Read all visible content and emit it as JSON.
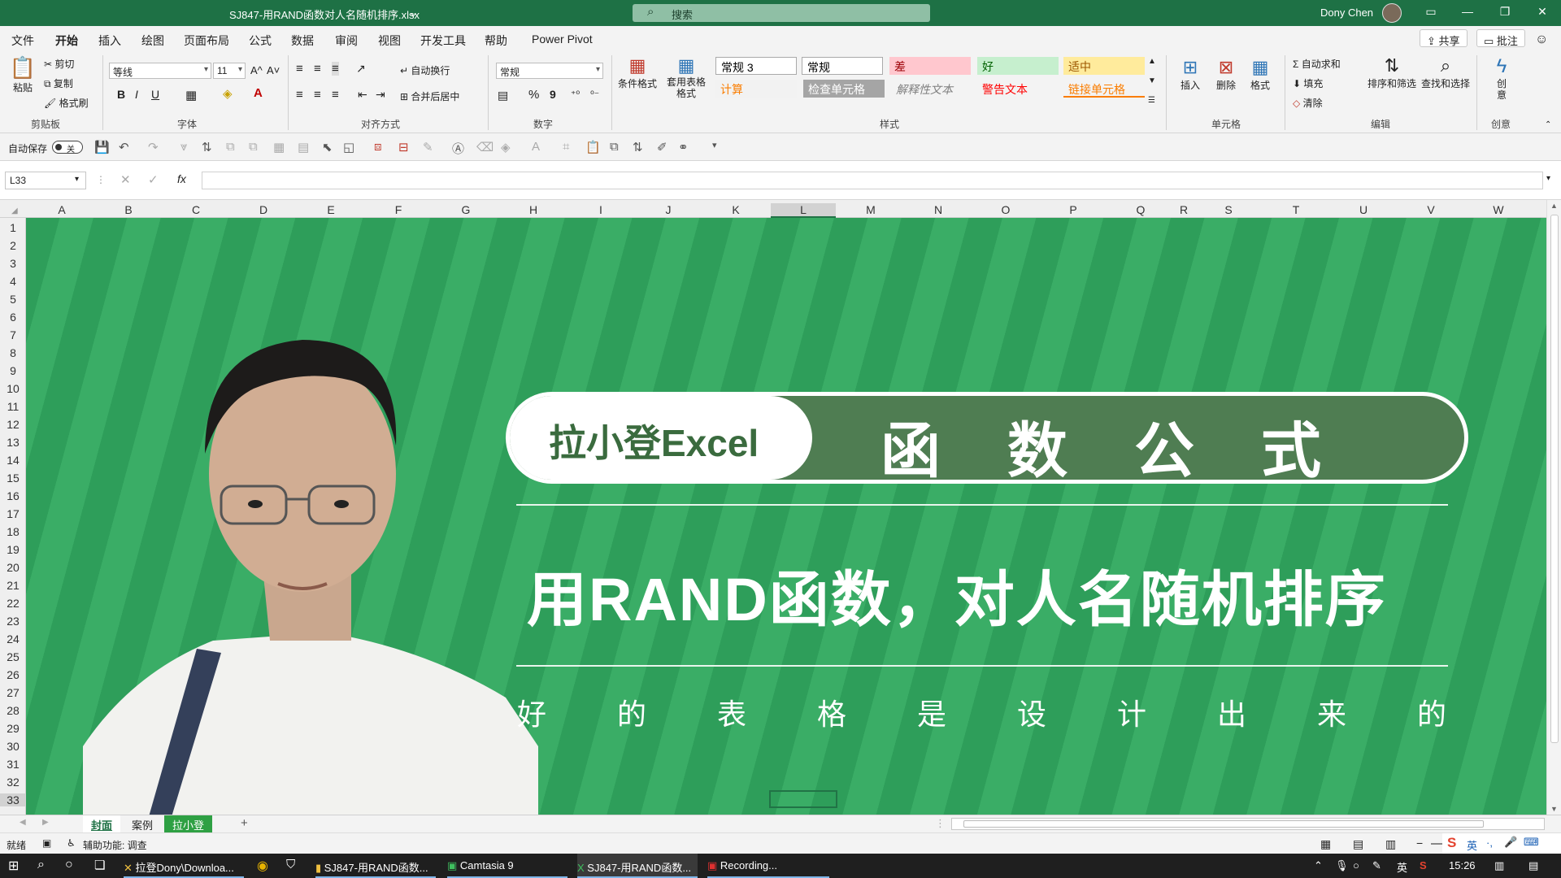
{
  "window": {
    "title": "SJ847-用RAND函数对人名随机排序.xlsx",
    "title_caret": "⌄",
    "search_placeholder": "搜索",
    "user": "Dony Chen"
  },
  "menu": {
    "items": [
      "文件",
      "开始",
      "插入",
      "绘图",
      "页面布局",
      "公式",
      "数据",
      "审阅",
      "视图",
      "开发工具",
      "帮助",
      "Power Pivot"
    ],
    "share": "共享",
    "comments": "批注"
  },
  "ribbon": {
    "clipboard": {
      "paste": "粘贴",
      "cut": "剪切",
      "copy": "复制",
      "painter": "格式刷",
      "label": "剪贴板"
    },
    "font": {
      "name": "等线",
      "size": "11",
      "bold": "B",
      "italic": "I",
      "underline": "U",
      "grow": "A^",
      "shrink": "A˅",
      "label": "字体"
    },
    "align": {
      "wrap": "自动换行",
      "merge": "合并后居中",
      "label": "对齐方式"
    },
    "number": {
      "format": "常规",
      "percent": "%",
      "comma": "9",
      "label": "数字"
    },
    "styles": {
      "cond": "条件格式",
      "table": "套用表格格式",
      "cells": [
        {
          "t": "常规 3",
          "bg": "#ffffff",
          "fg": "#000000"
        },
        {
          "t": "常规",
          "bg": "#ffffff",
          "fg": "#000000"
        },
        {
          "t": "差",
          "bg": "#ffc7ce",
          "fg": "#9c0006"
        },
        {
          "t": "好",
          "bg": "#c6efce",
          "fg": "#006100"
        },
        {
          "t": "适中",
          "bg": "#ffeb9c",
          "fg": "#9c5700"
        },
        {
          "t": "计算",
          "bg": "#f2f2f2",
          "fg": "#fa7d00"
        },
        {
          "t": "检查单元格",
          "bg": "#a5a5a5",
          "fg": "#ffffff"
        },
        {
          "t": "解释性文本",
          "bg": "#f3f3f3",
          "fg": "#7f7f7f"
        },
        {
          "t": "警告文本",
          "bg": "#f3f3f3",
          "fg": "#ff0000"
        },
        {
          "t": "链接单元格",
          "bg": "#f3f3f3",
          "fg": "#fa7d00"
        }
      ],
      "label": "样式"
    },
    "cells": {
      "insert": "插入",
      "delete": "删除",
      "format": "格式",
      "label": "单元格"
    },
    "editing": {
      "autosum": "自动求和",
      "fill": "填充",
      "clear": "清除",
      "sort": "排序和筛选",
      "find": "查找和选择",
      "label": "编辑"
    },
    "ideas": {
      "btn": "创意",
      "label": "创意"
    }
  },
  "qat": {
    "autosave": "自动保存",
    "toggle": "关"
  },
  "formula": {
    "namebox": "L33",
    "fx": "fx",
    "value": ""
  },
  "columns": [
    "A",
    "B",
    "C",
    "D",
    "E",
    "F",
    "G",
    "H",
    "I",
    "J",
    "K",
    "L",
    "M",
    "N",
    "O",
    "P",
    "Q",
    "R",
    "S",
    "T",
    "U",
    "V",
    "W"
  ],
  "rows": [
    "1",
    "2",
    "3",
    "4",
    "5",
    "6",
    "7",
    "8",
    "9",
    "10",
    "11",
    "12",
    "13",
    "14",
    "15",
    "16",
    "17",
    "18",
    "19",
    "20",
    "21",
    "22",
    "23",
    "24",
    "25",
    "26",
    "27",
    "28",
    "29",
    "30",
    "31",
    "32",
    "33"
  ],
  "cover": {
    "brand": "拉小登Excel",
    "title_chars": [
      "函",
      "数",
      "公",
      "式"
    ],
    "headline": "用RAND函数，对人名随机排序",
    "tagline_chars": [
      "好",
      "的",
      "表",
      "格",
      "是",
      "设",
      "计",
      "出",
      "来",
      "的"
    ]
  },
  "sheets": {
    "tabs": [
      "封面",
      "案例",
      "拉小登"
    ],
    "active": "封面",
    "add": "+"
  },
  "status": {
    "mode": "就绪",
    "accessibility": "辅助功能: 调查"
  },
  "taskbar": {
    "apps": [
      "拉登Dony\\Downloa...",
      "SJ847-用RAND函数...",
      "Camtasia 9",
      "SJ847-用RAND函数...",
      "Recording..."
    ],
    "ime": "英",
    "time": "15:26"
  }
}
